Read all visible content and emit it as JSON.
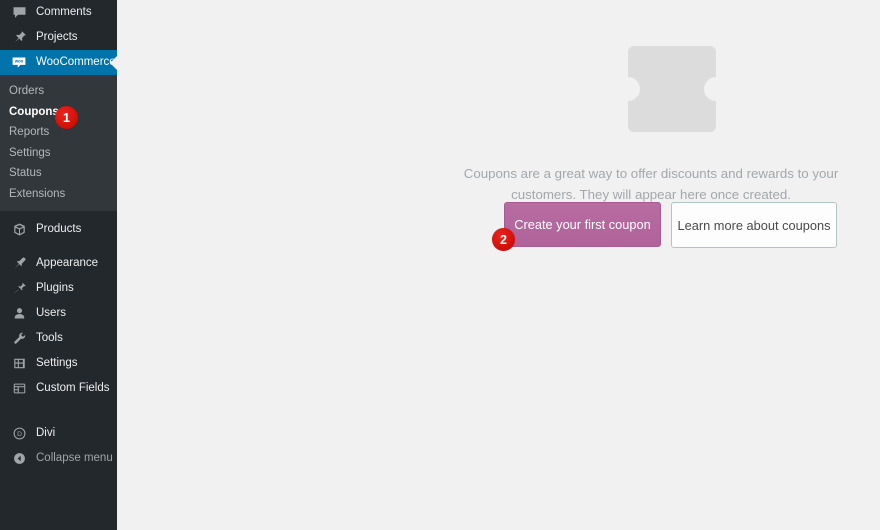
{
  "sidebar": {
    "background_color": "#23282d",
    "submenu_background_color": "#32373c",
    "active_color": "#0073aa",
    "items": [
      {
        "id": "comments",
        "label": "Comments",
        "icon": "comments-icon"
      },
      {
        "id": "projects",
        "label": "Projects",
        "icon": "pin-icon"
      },
      {
        "id": "woocommerce",
        "label": "WooCommerce",
        "icon": "woocommerce-icon"
      },
      {
        "id": "products",
        "label": "Products",
        "icon": "products-box-icon"
      },
      {
        "id": "appearance",
        "label": "Appearance",
        "icon": "paintbrush-icon"
      },
      {
        "id": "plugins",
        "label": "Plugins",
        "icon": "plug-icon"
      },
      {
        "id": "users",
        "label": "Users",
        "icon": "user-icon"
      },
      {
        "id": "tools",
        "label": "Tools",
        "icon": "wrench-icon"
      },
      {
        "id": "settings",
        "label": "Settings",
        "icon": "sliders-icon"
      },
      {
        "id": "custom-fields",
        "label": "Custom Fields",
        "icon": "table-icon"
      },
      {
        "id": "divi",
        "label": "Divi",
        "icon": "divi-circle-d-icon"
      },
      {
        "id": "collapse",
        "label": "Collapse menu",
        "icon": "collapse-arrow-icon"
      }
    ],
    "woocommerce_submenu": [
      {
        "id": "orders",
        "label": "Orders"
      },
      {
        "id": "coupons",
        "label": "Coupons"
      },
      {
        "id": "reports",
        "label": "Reports"
      },
      {
        "id": "settings",
        "label": "Settings"
      },
      {
        "id": "status",
        "label": "Status"
      },
      {
        "id": "extensions",
        "label": "Extensions"
      }
    ],
    "active_item": "WooCommerce",
    "active_submenu_item": "Coupons"
  },
  "annotations": {
    "badge_color": "#d8160f",
    "steps": [
      {
        "number": "1",
        "target": "coupons-submenu-item"
      },
      {
        "number": "2",
        "target": "create-your-first-coupon-button"
      }
    ]
  },
  "main": {
    "empty_state": {
      "illustration": "coupon-ticket-icon",
      "illustration_color": "#dcdcdc",
      "message": "Coupons are a great way to offer discounts and rewards to your customers. They will appear here once created.",
      "primary_button": {
        "label": "Create your first coupon",
        "background_color": "#b5689c",
        "text_color": "#ffffff"
      },
      "secondary_button": {
        "label": "Learn more about coupons",
        "background_color": "#fdfdfd",
        "border_color": "#b3c4c4",
        "text_color": "#4a4a4a"
      }
    },
    "background_color": "#f1f1f1",
    "text_color": "#a3a7ab"
  }
}
